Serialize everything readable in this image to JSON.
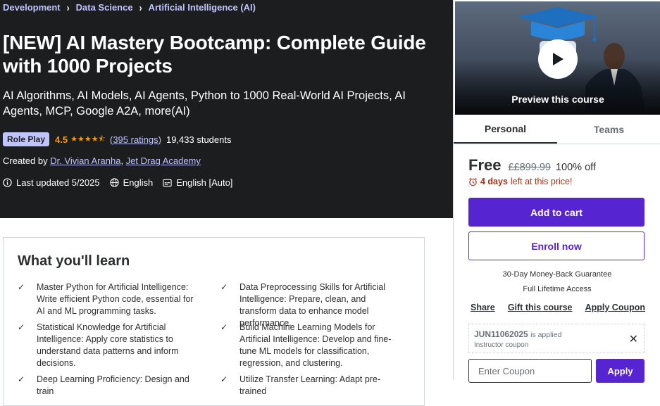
{
  "breadcrumb": [
    {
      "label": "Development"
    },
    {
      "label": "Data Science"
    },
    {
      "label": "Artificial Intelligence (AI)"
    }
  ],
  "course": {
    "title": "[NEW] AI Mastery Bootcamp: Complete Guide with 1000 Projects",
    "subtitle": "AI Algorithms, AI Models, AI Agents, Python to 1000 Real-World AI Projects, AI Agents, MCP, Google A2A, more(AI)",
    "badge": "Role Play",
    "rating": "4.5",
    "ratings_count": "(395 ratings)",
    "students": "19,433 students",
    "created_by_label": "Created by",
    "instructors": [
      "Dr. Vivian Aranha",
      "Jet Drag Academy"
    ],
    "last_updated": "Last updated 5/2025",
    "language": "English",
    "captions": "English [Auto]"
  },
  "learn": {
    "title": "What you'll learn",
    "items": [
      "Master Python for Artificial Intelligence: Write efficient Python code, essential for AI and ML programming tasks.",
      "Data Preprocessing Skills for Artificial Intelligence: Prepare, clean, and transform data to enhance model performance.",
      "Statistical Knowledge for Artificial Intelligence: Apply core statistics to understand data patterns and inform decisions.",
      "Build Machine Learning Models for Artificial Intelligence: Develop and fine-tune ML models for classification, regression, and clustering.",
      "Deep Learning Proficiency: Design and train",
      "Utilize Transfer Learning: Adapt pre-trained"
    ]
  },
  "card": {
    "preview_label": "Preview this course",
    "tabs": [
      "Personal",
      "Teams"
    ],
    "active_tab": "Personal",
    "price": "Free",
    "original_price": "££899.99",
    "discount": "100% off",
    "timer_days": "4 days",
    "timer_text": "left at this price!",
    "add_to_cart": "Add to cart",
    "enroll_now": "Enroll now",
    "guarantee": "30-Day Money-Back Guarantee",
    "lifetime": "Full Lifetime Access",
    "actions": [
      "Share",
      "Gift this course",
      "Apply Coupon"
    ],
    "coupon_code": "JUN11062025",
    "coupon_applied": "is applied",
    "coupon_sub": "Instructor coupon",
    "coupon_placeholder": "Enter Coupon",
    "apply_label": "Apply"
  },
  "colors": {
    "hero_bg": "#1c1d1f",
    "accent_purple": "#5624d0",
    "link_lavender": "#c0c4fc",
    "star_orange": "#f69c08",
    "timer_red": "#b32d0f"
  },
  "icons": [
    "chevron-right-icon",
    "star-icon",
    "info-icon",
    "globe-icon",
    "captions-icon",
    "check-icon",
    "play-icon",
    "alarm-icon",
    "close-icon"
  ]
}
